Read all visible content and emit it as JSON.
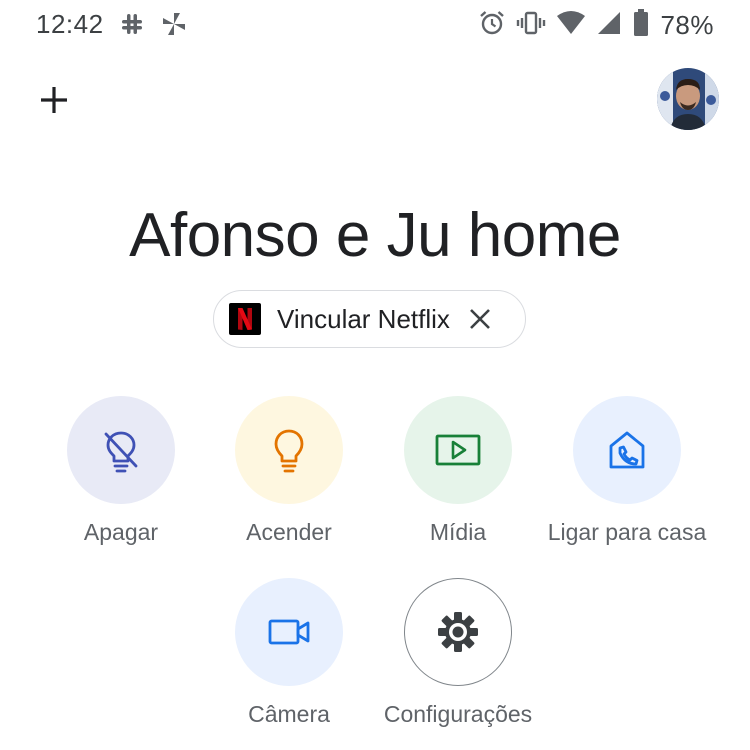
{
  "status_bar": {
    "time": "12:42",
    "left_icons": [
      "slack-icon",
      "pinwheel-icon"
    ],
    "right_icons": [
      "alarm-icon",
      "vibrate-icon",
      "wifi-icon",
      "signal-icon",
      "battery-icon"
    ],
    "battery_percent": "78%"
  },
  "header": {
    "add_icon": "plus-icon",
    "avatar": "user-avatar"
  },
  "home": {
    "title": "Afonso e Ju home"
  },
  "chip": {
    "label": "Vincular Netflix",
    "logo_letter": "N",
    "close_icon": "close-icon"
  },
  "actions": [
    {
      "label": "Apagar",
      "icon": "lightbulb-off-icon",
      "color": "#3f51b5"
    },
    {
      "label": "Acender",
      "icon": "lightbulb-icon",
      "color": "#e37400"
    },
    {
      "label": "Mídia",
      "icon": "media-play-icon",
      "color": "#188038"
    },
    {
      "label": "Ligar para casa",
      "icon": "home-phone-icon",
      "color": "#1a73e8"
    },
    {
      "label": "Câmera",
      "icon": "video-camera-icon",
      "color": "#1a73e8"
    },
    {
      "label": "Configurações",
      "icon": "gear-icon",
      "color": "#5f6368"
    }
  ]
}
